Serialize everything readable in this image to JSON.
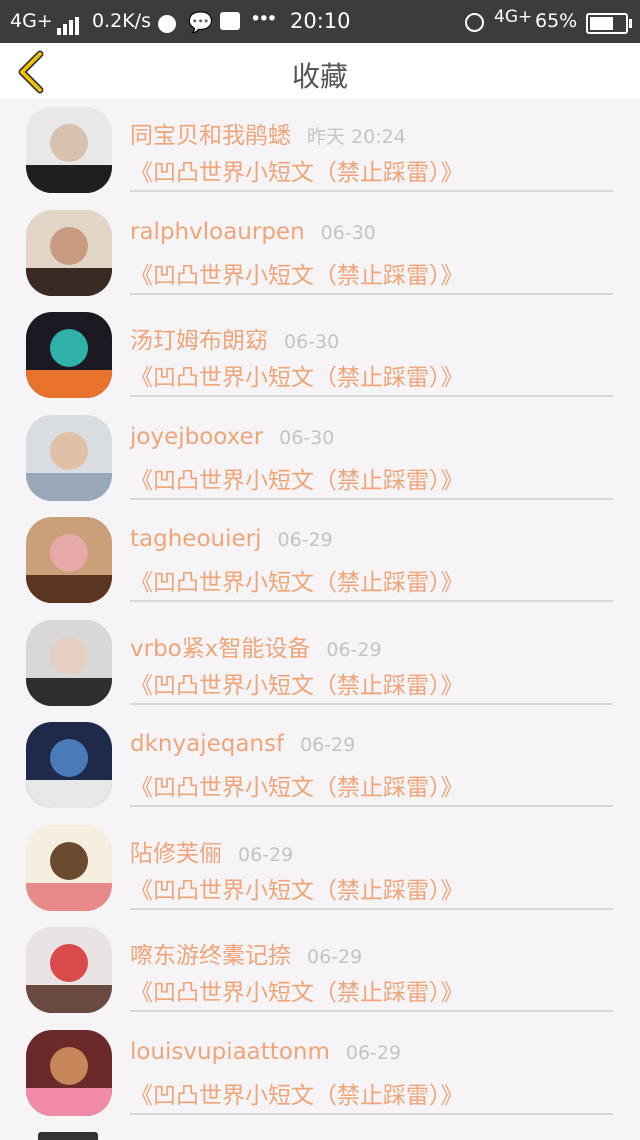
{
  "status_bar": {
    "network_left": "4G+",
    "speed": "0.2K/s",
    "dots": "•••",
    "time": "20:10",
    "network_right": "4G+",
    "battery": "65%"
  },
  "nav": {
    "title": "收藏"
  },
  "favorites": [
    {
      "name": "同宝贝和我鹃蟋",
      "date": "昨天 20:24",
      "article": "《凹凸世界小短文（禁止踩雷）》",
      "avatar_colors": [
        "#e8e8e8",
        "#1f1f1f",
        "#d9c1b0"
      ]
    },
    {
      "name": "ralphvloaurpen",
      "date": "06-30",
      "article": "《凹凸世界小短文（禁止踩雷）》",
      "avatar_colors": [
        "#e2d6c7",
        "#3a2a24",
        "#c89a80"
      ]
    },
    {
      "name": "汤玎姆布朗窈",
      "date": "06-30",
      "article": "《凹凸世界小短文（禁止踩雷）》",
      "avatar_colors": [
        "#1b1a22",
        "#e8712c",
        "#2fb0a8"
      ]
    },
    {
      "name": "joyejbooxer",
      "date": "06-30",
      "article": "《凹凸世界小短文（禁止踩雷）》",
      "avatar_colors": [
        "#d9dde2",
        "#9aa7b8",
        "#e1c0a8"
      ]
    },
    {
      "name": "tagheouierj",
      "date": "06-29",
      "article": "《凹凸世界小短文（禁止踩雷）》",
      "avatar_colors": [
        "#caa07a",
        "#5a3522",
        "#e7a8a8"
      ]
    },
    {
      "name": "vrbo紧x智能设备",
      "date": "06-29",
      "article": "《凹凸世界小短文（禁止踩雷）》",
      "avatar_colors": [
        "#d8d8d8",
        "#2e2e2e",
        "#e6cfc2"
      ]
    },
    {
      "name": "dknyajeqansf",
      "date": "06-29",
      "article": "《凹凸世界小短文（禁止踩雷）》",
      "avatar_colors": [
        "#1f2a4a",
        "#e7e7e7",
        "#4a7bb8"
      ]
    },
    {
      "name": "阽修芙俪",
      "date": "06-29",
      "article": "《凹凸世界小短文（禁止踩雷）》",
      "avatar_colors": [
        "#f6efe0",
        "#e88a8a",
        "#6b4a30"
      ]
    },
    {
      "name": "嚓东游终橐记捺",
      "date": "06-29",
      "article": "《凹凸世界小短文（禁止踩雷）》",
      "avatar_colors": [
        "#e9e3e3",
        "#6a4a40",
        "#d94a4a"
      ]
    },
    {
      "name": "louisvupiaattonm",
      "date": "06-29",
      "article": "《凹凸世界小短文（禁止踩雷）》",
      "avatar_colors": [
        "#6a2a2a",
        "#f08aa6",
        "#c7875a"
      ]
    }
  ]
}
